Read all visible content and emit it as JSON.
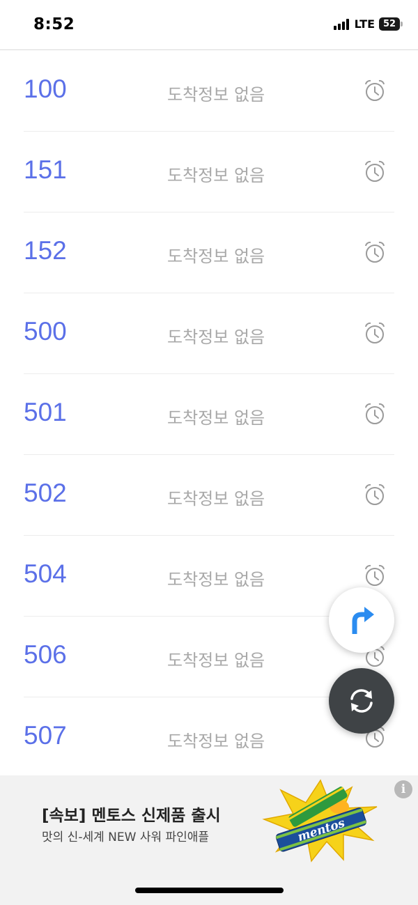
{
  "status_bar": {
    "time": "8:52",
    "network": "LTE",
    "battery": "52"
  },
  "routes": [
    {
      "number": "100",
      "arrival": "도착정보 없음"
    },
    {
      "number": "151",
      "arrival": "도착정보 없음"
    },
    {
      "number": "152",
      "arrival": "도착정보 없음"
    },
    {
      "number": "500",
      "arrival": "도착정보 없음"
    },
    {
      "number": "501",
      "arrival": "도착정보 없음"
    },
    {
      "number": "502",
      "arrival": "도착정보 없음"
    },
    {
      "number": "504",
      "arrival": "도착정보 없음"
    },
    {
      "number": "506",
      "arrival": "도착정보 없음"
    },
    {
      "number": "507",
      "arrival": "도착정보 없음"
    }
  ],
  "icons": {
    "row_action": "alarm-clock-icon",
    "direction": "turn-right-arrow-icon",
    "refresh": "refresh-icon",
    "ad_info": "info-icon"
  },
  "ad": {
    "title": "[속보] 멘토스 신제품 출시",
    "subtitle": "맛의 신-세계 NEW 사워 파인애플",
    "info_label": "i",
    "image_text": "mentos"
  },
  "colors": {
    "route_number": "#5b70e8",
    "arrival_text": "#a8a8a8",
    "direction_arrow": "#2b8cf0",
    "refresh_button": "#3f4346"
  }
}
